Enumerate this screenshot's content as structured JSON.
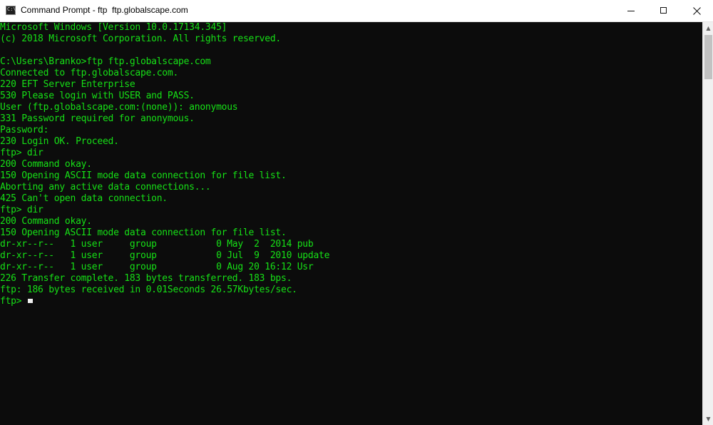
{
  "window": {
    "title": "Command Prompt - ftp  ftp.globalscape.com",
    "icon": "console-icon",
    "buttons": {
      "minimize": "minimize-icon",
      "maximize": "maximize-icon",
      "close": "close-icon"
    }
  },
  "terminal": {
    "text_color": "#16e016",
    "background": "#0c0c0c",
    "lines": [
      "Microsoft Windows [Version 10.0.17134.345]",
      "(c) 2018 Microsoft Corporation. All rights reserved.",
      "",
      "C:\\Users\\Branko>ftp ftp.globalscape.com",
      "Connected to ftp.globalscape.com.",
      "220 EFT Server Enterprise",
      "530 Please login with USER and PASS.",
      "User (ftp.globalscape.com:(none)): anonymous",
      "331 Password required for anonymous.",
      "Password:",
      "230 Login OK. Proceed.",
      "ftp> dir",
      "200 Command okay.",
      "150 Opening ASCII mode data connection for file list.",
      "Aborting any active data connections...",
      "425 Can't open data connection.",
      "ftp> dir",
      "200 Command okay.",
      "150 Opening ASCII mode data connection for file list.",
      "dr-xr--r--   1 user     group           0 May  2  2014 pub",
      "dr-xr--r--   1 user     group           0 Jul  9  2010 update",
      "dr-xr--r--   1 user     group           0 Aug 20 16:12 Usr",
      "226 Transfer complete. 183 bytes transferred. 183 bps.",
      "ftp: 186 bytes received in 0.01Seconds 26.57Kbytes/sec.",
      "ftp> "
    ]
  },
  "scrollbar": {
    "up_arrow": "▲",
    "down_arrow": "▼"
  }
}
